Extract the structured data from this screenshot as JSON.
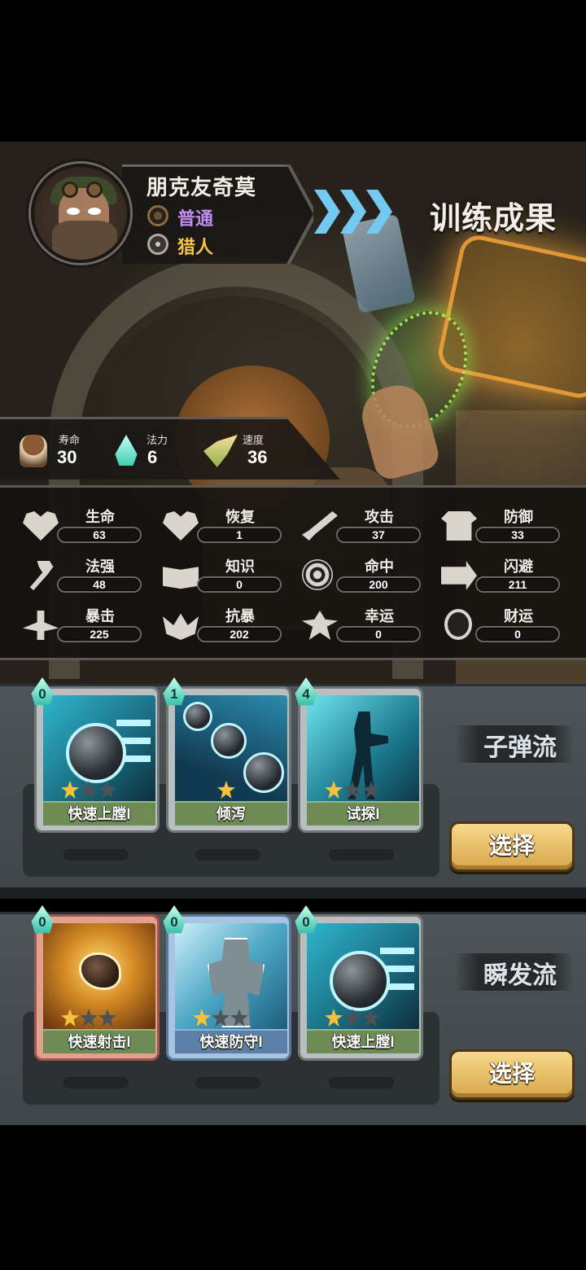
{
  "hero": {
    "name": "朋克友奇莫",
    "rarity": "普通",
    "class": "猎人"
  },
  "title": "训练成果",
  "basic_stats": [
    {
      "label": "寿命",
      "value": "30",
      "icon": "life-icon"
    },
    {
      "label": "法力",
      "value": "6",
      "icon": "mana-drop-icon"
    },
    {
      "label": "速度",
      "value": "36",
      "icon": "speed-icon"
    }
  ],
  "attributes": [
    {
      "label": "生命",
      "value": "63",
      "icon": "heart-icon"
    },
    {
      "label": "恢复",
      "value": "1",
      "icon": "heart-plus-icon"
    },
    {
      "label": "攻击",
      "value": "37",
      "icon": "sword-icon"
    },
    {
      "label": "防御",
      "value": "33",
      "icon": "armor-icon"
    },
    {
      "label": "法强",
      "value": "48",
      "icon": "wand-icon"
    },
    {
      "label": "知识",
      "value": "0",
      "icon": "book-icon"
    },
    {
      "label": "命中",
      "value": "200",
      "icon": "target-icon"
    },
    {
      "label": "闪避",
      "value": "211",
      "icon": "dodge-icon"
    },
    {
      "label": "暴击",
      "value": "225",
      "icon": "crit-icon"
    },
    {
      "label": "抗暴",
      "value": "202",
      "icon": "resist-icon"
    },
    {
      "label": "幸运",
      "value": "0",
      "icon": "clover-icon"
    },
    {
      "label": "财运",
      "value": "0",
      "icon": "coin-icon"
    }
  ],
  "builds": [
    {
      "title": "子弹流",
      "select_label": "选择",
      "cards": [
        {
          "name": "快速上膛I",
          "cost": "0",
          "stars": 1,
          "frame": "grey",
          "art": "cannon"
        },
        {
          "name": "倾泻",
          "cost": "1",
          "stars": 1,
          "frame": "grey",
          "art": "spill"
        },
        {
          "name": "试探I",
          "cost": "4",
          "stars": 1,
          "frame": "grey",
          "art": "probe"
        }
      ]
    },
    {
      "title": "瞬发流",
      "select_label": "选择",
      "cards": [
        {
          "name": "快速射击I",
          "cost": "0",
          "stars": 1,
          "frame": "red",
          "art": "shot"
        },
        {
          "name": "快速防守I",
          "cost": "0",
          "stars": 1,
          "frame": "blue",
          "art": "guard"
        },
        {
          "name": "快速上膛I",
          "cost": "0",
          "stars": 1,
          "frame": "grey",
          "art": "cannon"
        }
      ]
    }
  ],
  "colors": {
    "rarity": "#c08cf0",
    "class": "#f2c348",
    "chevron": "#74c9f2",
    "star_on": "#f6c23a",
    "button": "#d8a64b"
  }
}
